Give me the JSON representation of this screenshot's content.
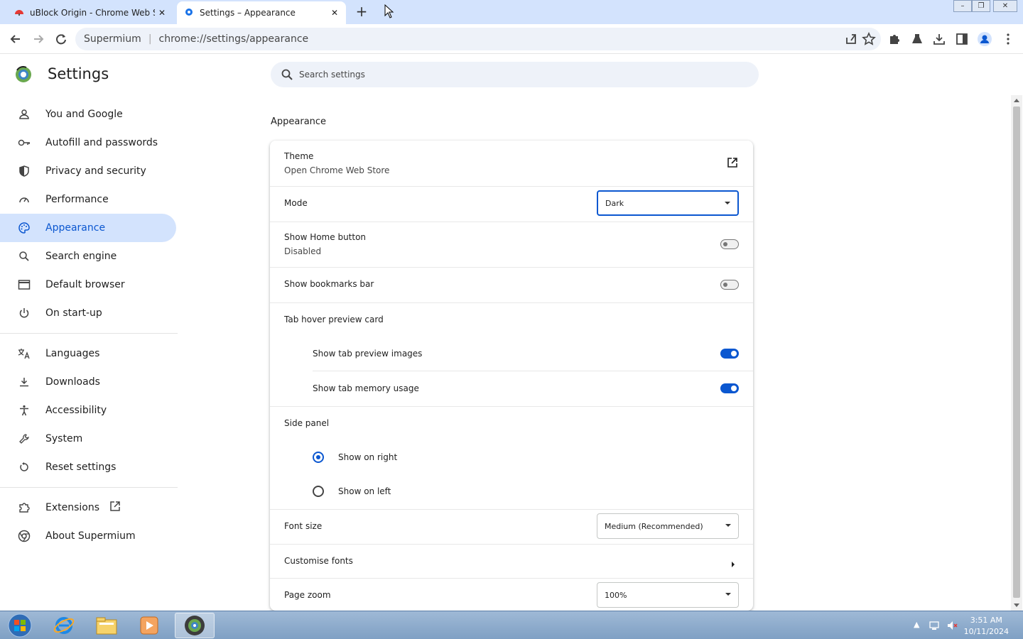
{
  "window": {
    "tabs": [
      {
        "title": "uBlock Origin - Chrome Web Sto",
        "active": false
      },
      {
        "title": "Settings – Appearance",
        "active": true
      }
    ],
    "new_tab": "+",
    "controls": {
      "minimize": "–",
      "restore": "❐",
      "close": "✕"
    }
  },
  "toolbar": {
    "origin": "Supermium",
    "url": "chrome://settings/appearance"
  },
  "sidebar": {
    "title": "Settings",
    "items": [
      {
        "label": "You and Google",
        "icon": "person-icon"
      },
      {
        "label": "Autofill and passwords",
        "icon": "key-icon"
      },
      {
        "label": "Privacy and security",
        "icon": "shield-icon"
      },
      {
        "label": "Performance",
        "icon": "speedometer-icon"
      },
      {
        "label": "Appearance",
        "icon": "palette-icon",
        "active": true
      },
      {
        "label": "Search engine",
        "icon": "search-icon"
      },
      {
        "label": "Default browser",
        "icon": "browser-window-icon"
      },
      {
        "label": "On start-up",
        "icon": "power-icon"
      },
      {
        "label": "Languages",
        "icon": "translate-icon"
      },
      {
        "label": "Downloads",
        "icon": "download-icon"
      },
      {
        "label": "Accessibility",
        "icon": "accessibility-icon"
      },
      {
        "label": "System",
        "icon": "wrench-icon"
      },
      {
        "label": "Reset settings",
        "icon": "reset-icon"
      },
      {
        "label": "Extensions",
        "icon": "puzzle-icon"
      },
      {
        "label": "About Supermium",
        "icon": "logo-icon"
      }
    ]
  },
  "search": {
    "placeholder": "Search settings"
  },
  "section": {
    "title": "Appearance"
  },
  "appearance": {
    "theme": {
      "label": "Theme",
      "sublabel": "Open Chrome Web Store"
    },
    "mode": {
      "label": "Mode",
      "value": "Dark"
    },
    "home_button": {
      "label": "Show Home button",
      "sublabel": "Disabled",
      "enabled": false
    },
    "bookmarks_bar": {
      "label": "Show bookmarks bar",
      "enabled": false
    },
    "tab_hover": {
      "label": "Tab hover preview card",
      "preview_images": {
        "label": "Show tab preview images",
        "enabled": true
      },
      "memory_usage": {
        "label": "Show tab memory usage",
        "enabled": true
      }
    },
    "side_panel": {
      "label": "Side panel",
      "options": [
        {
          "label": "Show on right",
          "checked": true
        },
        {
          "label": "Show on left",
          "checked": false
        }
      ]
    },
    "font_size": {
      "label": "Font size",
      "value": "Medium (Recommended)"
    },
    "customise_fonts": {
      "label": "Customise fonts"
    },
    "page_zoom": {
      "label": "Page zoom",
      "value": "100%"
    }
  },
  "taskbar": {
    "time": "3:51 AM",
    "date": "10/11/2024"
  },
  "colors": {
    "accent": "#0b57d0",
    "active_nav_bg": "#d3e3fd",
    "tabstrip": "#d3e3fd"
  }
}
